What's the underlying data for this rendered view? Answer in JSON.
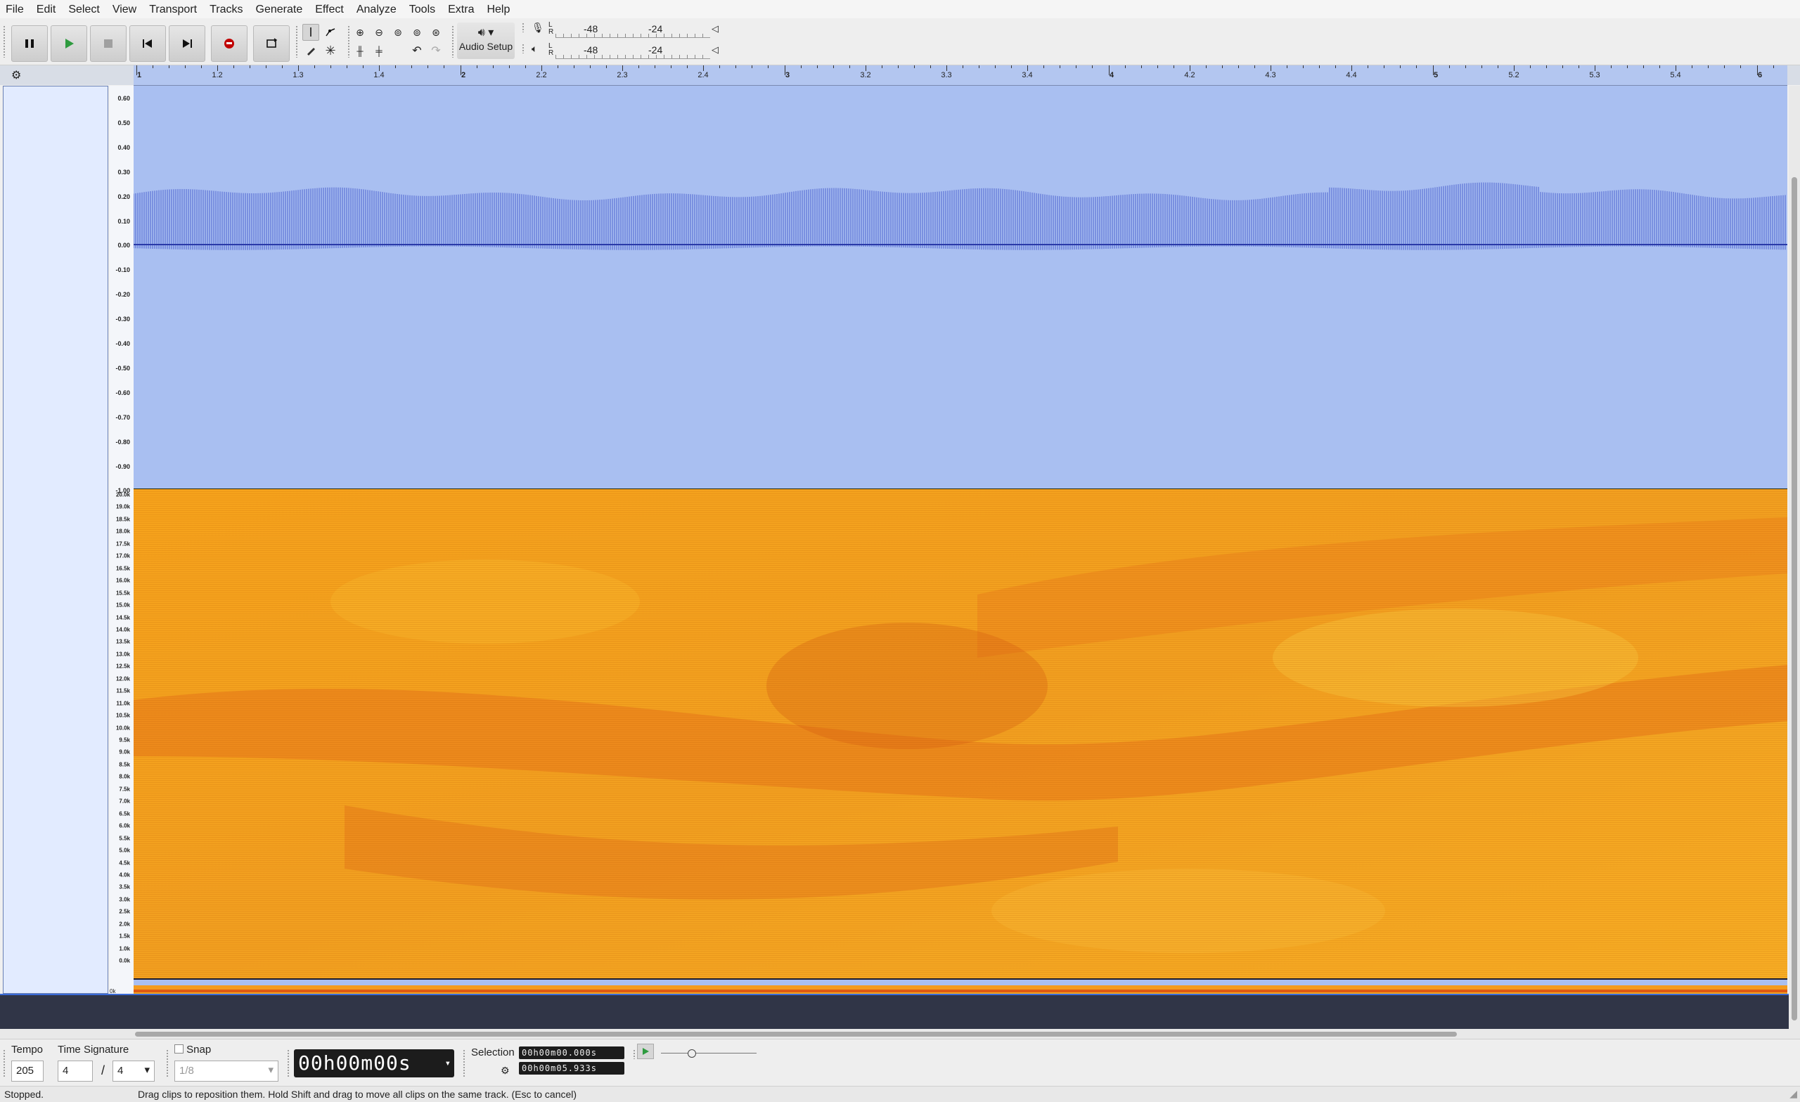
{
  "menu": [
    "File",
    "Edit",
    "Select",
    "View",
    "Transport",
    "Tracks",
    "Generate",
    "Effect",
    "Analyze",
    "Tools",
    "Extra",
    "Help"
  ],
  "toolbar": {
    "audio_setup_label": "Audio Setup",
    "record_meter": {
      "channels": "L R",
      "marks": [
        "-48",
        "-24"
      ]
    },
    "play_meter": {
      "channels": "L R",
      "marks": [
        "-48",
        "-24"
      ]
    }
  },
  "timeline": {
    "labels": [
      "1",
      "1.2",
      "1.3",
      "1.4",
      "2",
      "2.2",
      "2.3",
      "2.4",
      "3",
      "3.2",
      "3.3",
      "3.4",
      "4",
      "4.2",
      "4.3",
      "4.4",
      "5",
      "5.2",
      "5.3",
      "5.4",
      "6"
    ]
  },
  "wave_ruler": [
    "0.60",
    "0.50",
    "0.40",
    "0.30",
    "0.20",
    "0.10",
    "0.00",
    "-0.10",
    "-0.20",
    "-0.30",
    "-0.40",
    "-0.50",
    "-0.60",
    "-0.70",
    "-0.80",
    "-0.90",
    "-1.00"
  ],
  "spectrogram_ruler": [
    "20.0k",
    "19.0k",
    "18.5k",
    "18.0k",
    "17.5k",
    "17.0k",
    "16.5k",
    "16.0k",
    "15.5k",
    "15.0k",
    "14.5k",
    "14.0k",
    "13.5k",
    "13.0k",
    "12.5k",
    "12.0k",
    "11.5k",
    "11.0k",
    "10.5k",
    "10.0k",
    "9.5k",
    "9.0k",
    "8.5k",
    "8.0k",
    "7.5k",
    "7.0k",
    "6.5k",
    "6.0k",
    "5.5k",
    "5.0k",
    "4.5k",
    "4.0k",
    "3.5k",
    "3.0k",
    "2.5k",
    "2.0k",
    "1.5k",
    "1.0k",
    "0.0k"
  ],
  "strip_ruler": "0k",
  "bottom": {
    "tempo_label": "Tempo",
    "tempo_value": "205",
    "timesig_label": "Time Signature",
    "timesig_num": "4",
    "timesig_sep": "/",
    "timesig_den": "4",
    "snap_label": "Snap",
    "snap_value": "1/8",
    "time": "00h00m00s",
    "selection_label": "Selection",
    "sel_start": "00h00m00.000s",
    "sel_end": "00h00m05.933s"
  },
  "status": {
    "state": "Stopped.",
    "hint": "Drag clips to reposition them. Hold Shift and drag to move all clips on the same track. (Esc to cancel)"
  },
  "colors": {
    "waveform_bg": "#a9bff1",
    "waveform": "#3c4fc8",
    "spectrogram": "#f2a523",
    "accent": "#c00000"
  }
}
